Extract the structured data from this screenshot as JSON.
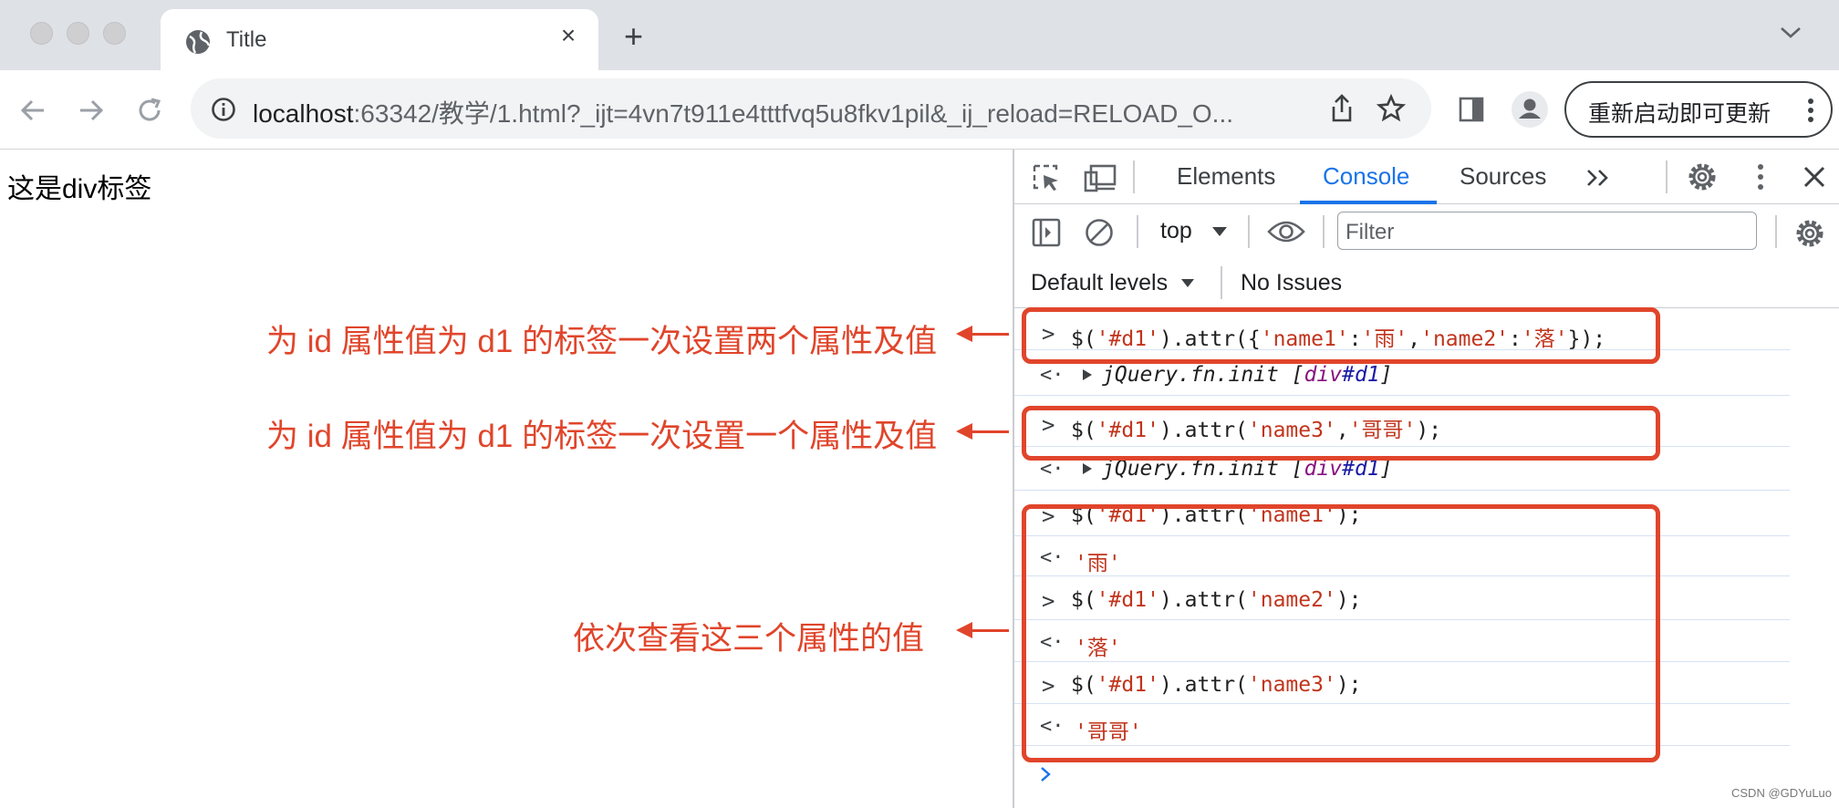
{
  "browser": {
    "tab_title": "Title",
    "new_tab": "+",
    "url_host": "localhost",
    "url_rest": ":63342/教学/1.html?_ijt=4vn7t911e4tttfvq5u8fkv1pil&_ij_reload=RELOAD_O...",
    "update_button": "重新启动即可更新"
  },
  "page": {
    "text": "这是div标签"
  },
  "devtools": {
    "tabs": [
      "Elements",
      "Console",
      "Sources"
    ],
    "active_tab": "Console",
    "context": "top",
    "filter_placeholder": "Filter",
    "levels": "Default levels",
    "issues": "No Issues",
    "lines": [
      {
        "kind": "input",
        "parts": [
          "$(",
          "'#d1'",
          ").attr({",
          "'name1'",
          ":",
          "'雨'",
          ",",
          "'name2'",
          ":",
          "'落'",
          "});"
        ]
      },
      {
        "kind": "output",
        "text": "jQuery.fn.init [",
        "tag": "div",
        "id": "#d1",
        "close": "]"
      },
      {
        "kind": "input",
        "parts": [
          "$(",
          "'#d1'",
          ").attr(",
          "'name3'",
          ",",
          "'哥哥'",
          ");"
        ]
      },
      {
        "kind": "output",
        "text": "jQuery.fn.init [",
        "tag": "div",
        "id": "#d1",
        "close": "]"
      },
      {
        "kind": "input",
        "parts": [
          "$(",
          "'#d1'",
          ").attr(",
          "'name1'",
          ");"
        ]
      },
      {
        "kind": "result",
        "text": "'雨'"
      },
      {
        "kind": "input",
        "parts": [
          "$(",
          "'#d1'",
          ").attr(",
          "'name2'",
          ");"
        ]
      },
      {
        "kind": "result",
        "text": "'落'"
      },
      {
        "kind": "input",
        "parts": [
          "$(",
          "'#d1'",
          ").attr(",
          "'name3'",
          ");"
        ]
      },
      {
        "kind": "result",
        "text": "'哥哥'"
      }
    ]
  },
  "annotations": {
    "a1": "为 id 属性值为 d1 的标签一次设置两个属性及值",
    "a2": "为 id 属性值为 d1 的标签一次设置一个属性及值",
    "a3": "依次查看这三个属性的值"
  },
  "watermark": "CSDN @GDYuLuo",
  "colors": {
    "annotation_red": "#e0452b",
    "console_blue": "#1a73e8",
    "string_red": "#c1341c"
  }
}
